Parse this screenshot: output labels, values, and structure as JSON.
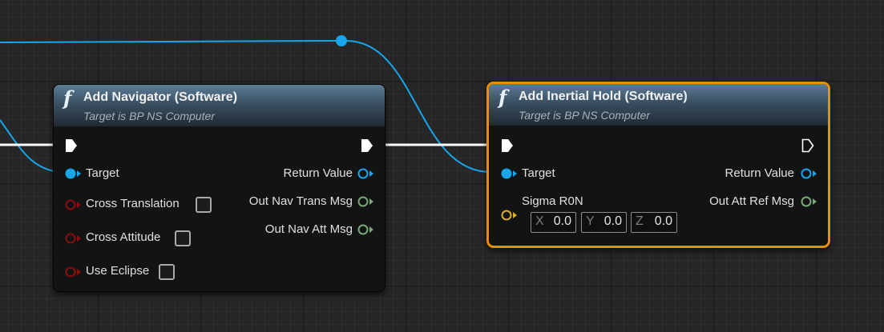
{
  "colors": {
    "exec": "#ffffff",
    "object_pin": "#17a5ec",
    "bool_pin": "#8b0e0e",
    "struct_pin": "#7aa878",
    "vector_pin": "#dcae28",
    "selection": "#e88f00"
  },
  "nodes": [
    {
      "title": "Add Navigator (Software)",
      "subtitle": "Target is BP NS Computer",
      "icon": "function-icon",
      "inputs": [
        {
          "label": "Target",
          "type": "object"
        },
        {
          "label": "Cross Translation",
          "type": "bool"
        },
        {
          "label": "Cross Attitude",
          "type": "bool"
        },
        {
          "label": "Use Eclipse",
          "type": "bool"
        }
      ],
      "outputs": [
        {
          "label": "Return Value",
          "type": "object"
        },
        {
          "label": "Out Nav Trans Msg",
          "type": "struct"
        },
        {
          "label": "Out Nav Att Msg",
          "type": "struct"
        }
      ]
    },
    {
      "title": "Add Inertial Hold (Software)",
      "subtitle": "Target is BP NS Computer",
      "icon": "function-icon",
      "selected": true,
      "inputs": [
        {
          "label": "Target",
          "type": "object"
        },
        {
          "label": "Sigma R0N",
          "type": "vector",
          "components": [
            {
              "axis": "X",
              "value": "0.0"
            },
            {
              "axis": "Y",
              "value": "0.0"
            },
            {
              "axis": "Z",
              "value": "0.0"
            }
          ]
        }
      ],
      "outputs": [
        {
          "label": "Return Value",
          "type": "object"
        },
        {
          "label": "Out Att Ref Msg",
          "type": "struct"
        }
      ]
    }
  ]
}
